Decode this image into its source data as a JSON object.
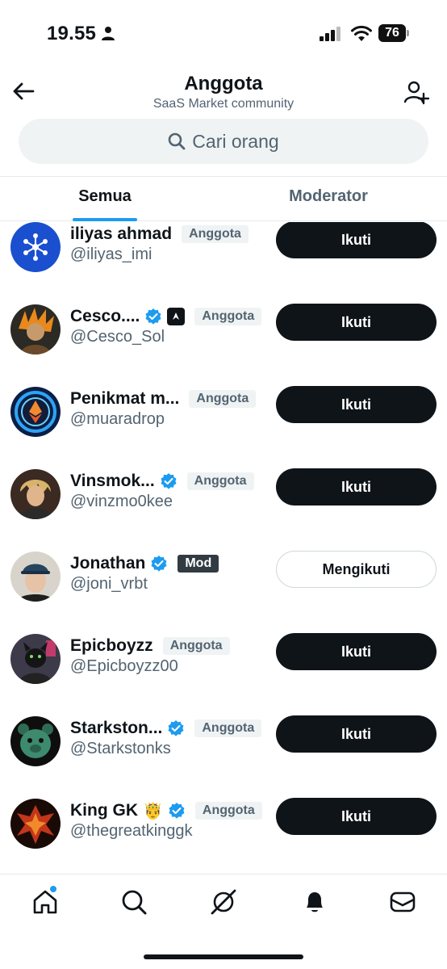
{
  "status_bar": {
    "time": "19.55",
    "battery": "76"
  },
  "header": {
    "title": "Anggota",
    "subtitle": "SaaS Market community"
  },
  "search": {
    "placeholder": "Cari orang"
  },
  "tabs": [
    {
      "label": "Semua",
      "active": true
    },
    {
      "label": "Moderator",
      "active": false
    }
  ],
  "members": [
    {
      "name": "iliyas ahmad",
      "handle": "@iliyas_imi",
      "role": "Anggota",
      "verified": false,
      "button": "Ikuti",
      "following": false,
      "avatar": "network-logo"
    },
    {
      "name": "Cesco....",
      "handle": "@Cesco_Sol",
      "role": "Anggota",
      "verified": true,
      "affiliate": true,
      "button": "Ikuti",
      "following": false,
      "avatar": "orange-hair-character"
    },
    {
      "name": "Penikmat m...",
      "handle": "@muaradrop",
      "role": "Anggota",
      "verified": false,
      "button": "Ikuti",
      "following": false,
      "avatar": "ethereum-logo"
    },
    {
      "name": "Vinsmok...",
      "handle": "@vinzmo0kee",
      "role": "Anggota",
      "verified": true,
      "button": "Ikuti",
      "following": false,
      "avatar": "anime-character"
    },
    {
      "name": "Jonathan",
      "handle": "@joni_vrbt",
      "role": "Mod",
      "verified": true,
      "button": "Mengikuti",
      "following": true,
      "avatar": "man-with-cap"
    },
    {
      "name": "Epicboyzz",
      "handle": "@Epicboyzz00",
      "role": "Anggota",
      "verified": false,
      "button": "Ikuti",
      "following": false,
      "avatar": "panther-character"
    },
    {
      "name": "Starkston...",
      "handle": "@Starkstonks",
      "role": "Anggota",
      "verified": true,
      "button": "Ikuti",
      "following": false,
      "avatar": "green-bear-character"
    },
    {
      "name": "King GK",
      "handle": "@thegreatkinggk",
      "role": "Anggota",
      "verified": true,
      "emoji": "🤴",
      "button": "Ikuti",
      "following": false,
      "avatar": "fire-phoenix"
    }
  ],
  "bottom_nav": [
    {
      "icon": "home-icon",
      "has_dot": true
    },
    {
      "icon": "search-icon"
    },
    {
      "icon": "grok-icon"
    },
    {
      "icon": "bell-icon"
    },
    {
      "icon": "mail-icon"
    }
  ],
  "colors": {
    "accent": "#1d9bf0",
    "button_dark": "#0f1419",
    "muted": "#536471",
    "badge_bg": "#eff3f4"
  }
}
